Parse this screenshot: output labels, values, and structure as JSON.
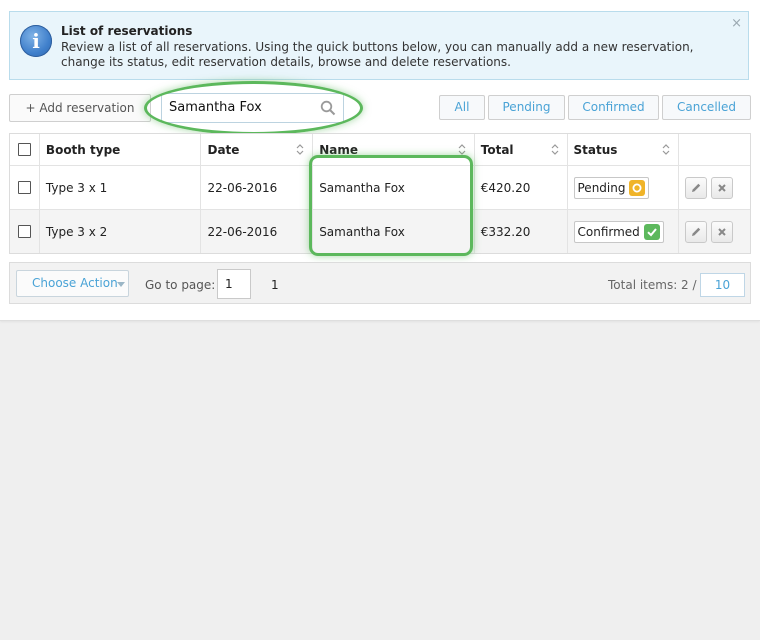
{
  "info": {
    "title": "List of reservations",
    "description": "Review a list of all reservations. Using the quick buttons below, you can manually add a new reservation, change its status, edit reservation details, browse and delete reservations.",
    "close": "×"
  },
  "toolbar": {
    "add_label": "+ Add reservation",
    "search_value": "Samantha Fox",
    "filters": [
      "All",
      "Pending",
      "Confirmed",
      "Cancelled"
    ]
  },
  "table": {
    "headers": [
      "Booth type",
      "Date",
      "Name",
      "Total",
      "Status"
    ],
    "rows": [
      {
        "booth": "Type 3 x 1",
        "date": "22-06-2016",
        "name": "Samantha Fox",
        "total": "€420.20",
        "status": "Pending"
      },
      {
        "booth": "Type 3 x 2",
        "date": "22-06-2016",
        "name": "Samantha Fox",
        "total": "€332.20",
        "status": "Confirmed"
      }
    ]
  },
  "footer": {
    "choose_action": "Choose Action",
    "goto_label": "Go to page:",
    "goto_value": "1",
    "page_count": "1",
    "total_label": "Total items: 2 /",
    "per_page": "10"
  },
  "colors": {
    "accent": "#4aa3d6",
    "highlight": "#5cb85c",
    "pending": "#f0b429",
    "confirmed": "#5cb85c"
  }
}
